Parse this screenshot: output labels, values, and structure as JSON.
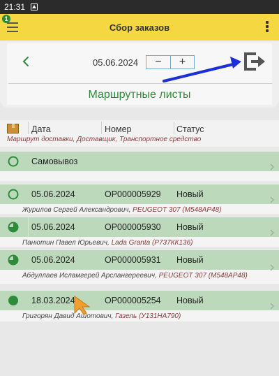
{
  "status_bar": {
    "time": "21:31"
  },
  "app_bar": {
    "title": "Сбор заказов",
    "badge_count": "1"
  },
  "toolbar": {
    "date": "05.06.2024",
    "minus_label": "−",
    "plus_label": "+"
  },
  "section": {
    "title": "Маршрутные листы"
  },
  "table": {
    "headers": {
      "date": "Дата",
      "number": "Номер",
      "status": "Статус"
    },
    "subheader": "Маршрут доставки, Доставщик, Транспортное средство",
    "rows": [
      {
        "status_icon": "empty-circle-icon",
        "date": "Самовывоз",
        "number": "",
        "status": "",
        "driver": "",
        "vehicle": ""
      },
      {
        "status_icon": "empty-circle-icon",
        "date": "05.06.2024",
        "number": "ОР000005929",
        "status": "Новый",
        "driver": "Журилов Сергей Александрович",
        "vehicle": "PEUGEOT 307 (М548АР48)"
      },
      {
        "status_icon": "partial-circle-icon",
        "date": "05.06.2024",
        "number": "ОР000005930",
        "status": "Новый",
        "driver": "Панютин Павел Юрьевич",
        "vehicle": "Lada Granta (Р737КК136)"
      },
      {
        "status_icon": "partial-circle-icon",
        "date": "05.06.2024",
        "number": "ОР000005931",
        "status": "Новый",
        "driver": "Абдуллаев Исламгерей Арслангереевич",
        "vehicle": "PEUGEOT 307 (М548АР48)"
      },
      {
        "status_icon": "full-circle-icon",
        "date": "18.03.2024",
        "number": "ОР000005254",
        "status": "Новый",
        "driver": "Григорян Давид Ашотович",
        "vehicle": "Газель (У131НА790)"
      }
    ]
  },
  "colors": {
    "app_bar": "#f5d742",
    "accent_green": "#2f8a3a",
    "row_band": "#bcd9bb",
    "annotation_arrow": "#1a2fd6"
  }
}
